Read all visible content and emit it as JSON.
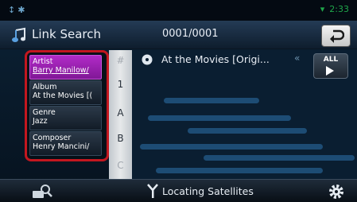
{
  "status_bar": {
    "time": "2:33",
    "left_icons": [
      "usb-icon",
      "bluetooth-icon"
    ],
    "wifi_icon": "wifi-icon"
  },
  "header": {
    "title": "Link Search",
    "counter": "0001/0001",
    "back_icon": "return-icon"
  },
  "categories": [
    {
      "label": "Artist",
      "value": "Barry Manilow/",
      "selected": true
    },
    {
      "label": "Album",
      "value": "At the Movies [(",
      "selected": false
    },
    {
      "label": "Genre",
      "value": "Jazz",
      "selected": false
    },
    {
      "label": "Composer",
      "value": "Henry Mancini/",
      "selected": false
    }
  ],
  "index": [
    "#",
    "1",
    "A",
    "B",
    "C"
  ],
  "list": [
    {
      "icon": "disc-icon",
      "label": "At the Movies [Origi...",
      "scroll_glyph": "«"
    }
  ],
  "all_button": {
    "label": "ALL",
    "icon": "play-icon"
  },
  "bottom_bar": {
    "status": "Locating Satellites",
    "left_icon": "search-list-icon",
    "right_icon": "settings-icon"
  },
  "colors": {
    "highlight_border": "#c3171f",
    "selected_item": "#a424bb",
    "clock": "#1fa64a"
  }
}
